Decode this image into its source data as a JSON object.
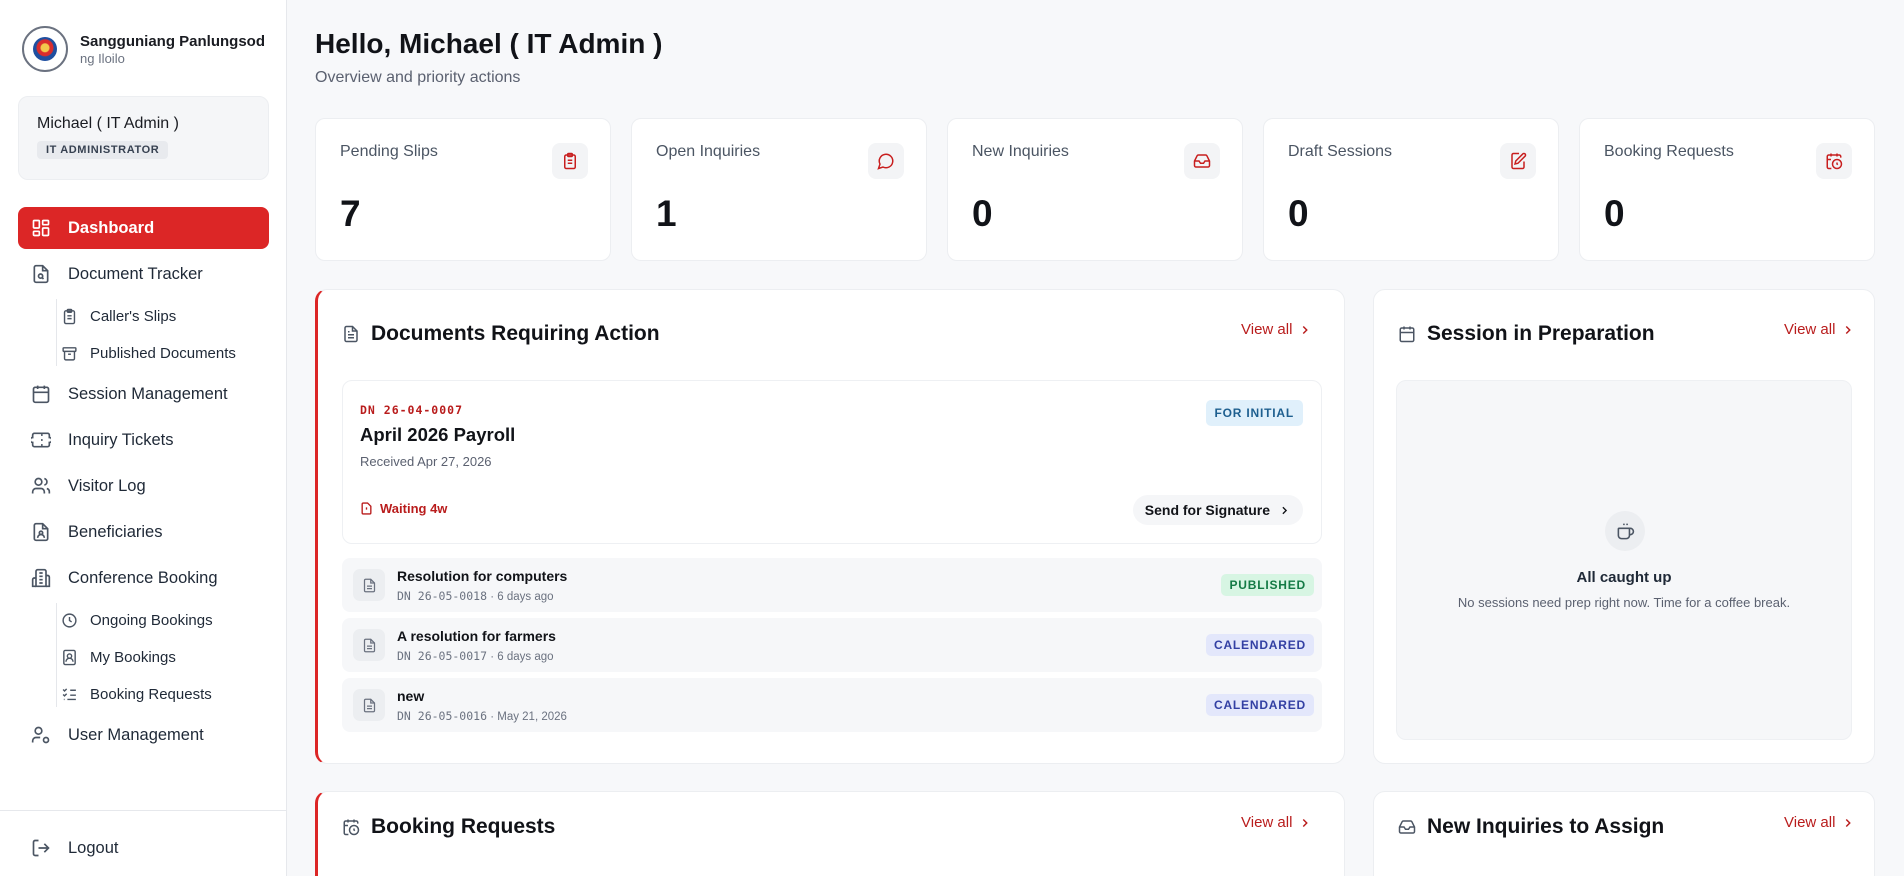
{
  "brand": {
    "title": "Sangguniang Panlungsod",
    "subtitle": "ng Iloilo"
  },
  "user": {
    "name": "Michael ( IT Admin )",
    "role": "IT ADMINISTRATOR"
  },
  "nav": {
    "dashboard": "Dashboard",
    "document_tracker": "Document Tracker",
    "callers_slips": "Caller's Slips",
    "published_documents": "Published Documents",
    "session_management": "Session Management",
    "inquiry_tickets": "Inquiry Tickets",
    "visitor_log": "Visitor Log",
    "beneficiaries": "Beneficiaries",
    "conference_booking": "Conference Booking",
    "ongoing_bookings": "Ongoing Bookings",
    "my_bookings": "My Bookings",
    "booking_requests": "Booking Requests",
    "user_management": "User Management",
    "logout": "Logout"
  },
  "header": {
    "greeting": "Hello, Michael ( IT Admin )",
    "subtitle": "Overview and priority actions"
  },
  "stats": [
    {
      "label": "Pending Slips",
      "value": "7",
      "icon": "clipboard-icon"
    },
    {
      "label": "Open Inquiries",
      "value": "1",
      "icon": "chat-bubble-icon"
    },
    {
      "label": "New Inquiries",
      "value": "0",
      "icon": "inbox-icon"
    },
    {
      "label": "Draft Sessions",
      "value": "0",
      "icon": "edit-note-icon"
    },
    {
      "label": "Booking Requests",
      "value": "0",
      "icon": "calendar-clock-icon"
    }
  ],
  "documents": {
    "title": "Documents Requiring Action",
    "view_all": "View all",
    "featured": {
      "dn": "DN 26-04-0007",
      "title": "April 2026 Payroll",
      "received": "Received Apr 27, 2026",
      "badge": "FOR INITIAL",
      "waiting": "Waiting 4w",
      "action": "Send for Signature"
    },
    "rows": [
      {
        "title": "Resolution for computers",
        "dn": "DN 26-05-0018",
        "meta": " · 6 days ago",
        "badge": "PUBLISHED"
      },
      {
        "title": "A resolution for farmers",
        "dn": "DN 26-05-0017",
        "meta": " · 6 days ago",
        "badge": "CALENDARED"
      },
      {
        "title": "new",
        "dn": "DN 26-05-0016",
        "meta": " · May 21, 2026",
        "badge": "CALENDARED"
      }
    ]
  },
  "session": {
    "title": "Session in Preparation",
    "view_all": "View all",
    "empty_title": "All caught up",
    "empty_sub": "No sessions need prep right now. Time for a coffee break."
  },
  "booking": {
    "title": "Booking Requests",
    "view_all": "View all"
  },
  "inquiries": {
    "title": "New Inquiries to Assign",
    "view_all": "View all"
  },
  "colors": {
    "accent": "#dc2626",
    "link": "#b91c1c",
    "published": "#137a45",
    "calendared": "#3340a3",
    "initial": "#1e5f8f"
  }
}
